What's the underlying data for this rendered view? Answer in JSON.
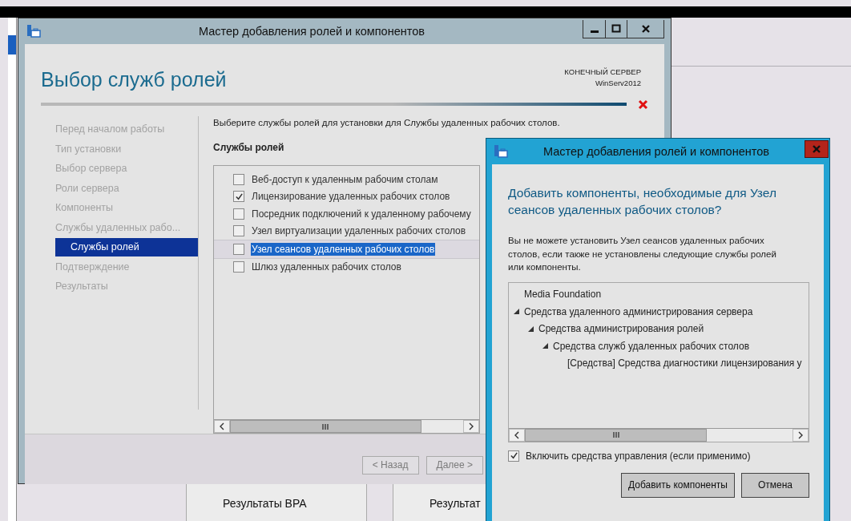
{
  "background": {
    "tiles": [
      {
        "label": "Результаты BPA"
      },
      {
        "label": "Результат"
      }
    ]
  },
  "wizard": {
    "title": "Мастер добавления ролей и компонентов",
    "page_title": "Выбор служб ролей",
    "destination_label": "КОНЕЧНЫЙ СЕРВЕР",
    "destination_server": "WinServ2012",
    "steps": [
      {
        "label": "Перед началом работы",
        "selected": false
      },
      {
        "label": "Тип установки",
        "selected": false
      },
      {
        "label": "Выбор сервера",
        "selected": false
      },
      {
        "label": "Роли сервера",
        "selected": false
      },
      {
        "label": "Компоненты",
        "selected": false
      },
      {
        "label": "Службы удаленных рабо...",
        "selected": false,
        "children": [
          {
            "label": "Службы ролей",
            "selected": true
          }
        ]
      },
      {
        "label": "Подтверждение",
        "selected": false
      },
      {
        "label": "Результаты",
        "selected": false
      }
    ],
    "instruction": "Выберите службы ролей для установки для Службы удаленных рабочих столов.",
    "list_heading": "Службы ролей",
    "role_services": [
      {
        "label": "Веб-доступ к удаленным рабочим столам",
        "checked": false,
        "selected": false
      },
      {
        "label": "Лицензирование удаленных рабочих столов",
        "checked": true,
        "selected": false
      },
      {
        "label": "Посредник подключений к удаленному рабочему",
        "checked": false,
        "selected": false
      },
      {
        "label": "Узел виртуализации удаленных рабочих столов",
        "checked": false,
        "selected": false
      },
      {
        "label": "Узел сеансов удаленных рабочих столов",
        "checked": false,
        "selected": true
      },
      {
        "label": "Шлюз удаленных рабочих столов",
        "checked": false,
        "selected": false
      }
    ],
    "buttons": [
      {
        "label": "< Назад"
      },
      {
        "label": "Далее >"
      }
    ]
  },
  "dialog": {
    "title": "Мастер добавления ролей и компонентов",
    "heading": "Добавить компоненты, необходимые для Узел сеансов удаленных рабочих столов?",
    "message": "Вы не можете установить Узел сеансов удаленных рабочих столов, если также не установлены следующие службы ролей или компоненты.",
    "features": [
      {
        "label": "Media Foundation"
      },
      {
        "label": "Средства удаленного администрирования сервера",
        "expanded": true,
        "children": [
          {
            "label": "Средства администрирования ролей",
            "expanded": true,
            "children": [
              {
                "label": "Средства служб удаленных рабочих столов",
                "expanded": true,
                "children": [
                  {
                    "label": "[Средства] Средства диагностики лицензирования у"
                  }
                ]
              }
            ]
          }
        ]
      }
    ],
    "include_tools": {
      "label": "Включить средства управления (если применимо)",
      "checked": true
    },
    "buttons": [
      {
        "label": "Добавить компоненты"
      },
      {
        "label": "Отмена"
      }
    ]
  }
}
